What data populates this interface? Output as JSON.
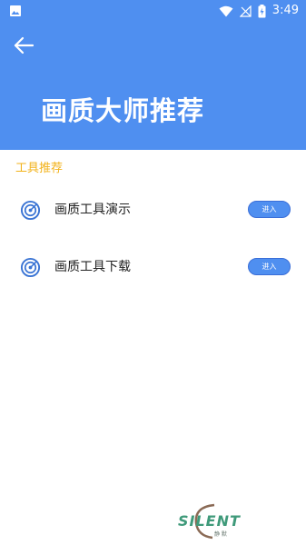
{
  "status_bar": {
    "time": "3:49",
    "icons": [
      "image-icon",
      "wifi-icon",
      "no-signal-icon",
      "battery-charging-icon"
    ]
  },
  "header": {
    "back_icon": "arrow-left-icon",
    "title": "画质大师推荐"
  },
  "section": {
    "title": "工具推荐"
  },
  "items": [
    {
      "icon": "target-icon",
      "label": "画质工具演示",
      "button": "进入"
    },
    {
      "icon": "target-icon",
      "label": "画质工具下载",
      "button": "进入"
    }
  ],
  "watermark": {
    "text": "SILENT",
    "sub": "静 默"
  },
  "colors": {
    "header_bg": "#4f8ff0",
    "section_title": "#f2b21a",
    "button_bg": "#4f8ff0",
    "watermark": "#3f9a7a"
  }
}
